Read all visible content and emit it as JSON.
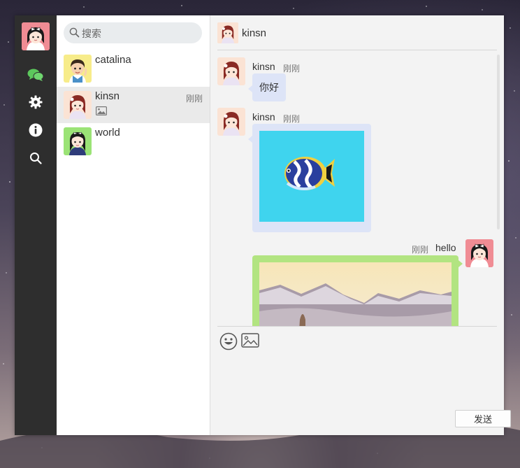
{
  "colors": {
    "nav_bg": "#2e2e2e",
    "accent_green": "#b2e481",
    "bubble_blue": "#dde4f7",
    "my_avatar": "#f08c94"
  },
  "nav": {
    "items": [
      "chat-icon",
      "gear-icon",
      "info-icon",
      "search-icon"
    ]
  },
  "search": {
    "placeholder": "搜索"
  },
  "conversations": [
    {
      "name": "catalina",
      "time": "",
      "preview_icon": ""
    },
    {
      "name": "kinsn",
      "time": "刚刚",
      "preview_icon": "image-icon"
    },
    {
      "name": "world",
      "time": "",
      "preview_icon": ""
    }
  ],
  "chat": {
    "title": "kinsn",
    "messages": [
      {
        "from": "kinsn",
        "time": "刚刚",
        "text": "你好"
      },
      {
        "from": "kinsn",
        "time": "刚刚",
        "image": "fish-image"
      },
      {
        "from": "me",
        "time": "刚刚",
        "text": "hello",
        "image": "mountain-image"
      }
    ]
  },
  "composer": {
    "send_label": "发送",
    "tools": [
      "emoji-icon",
      "image-icon"
    ]
  }
}
